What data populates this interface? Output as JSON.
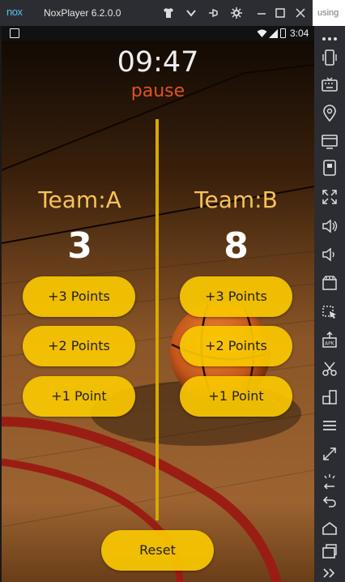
{
  "window": {
    "logo_text": "nox",
    "title": "NoxPlayer 6.2.0.0",
    "overflow_text": "using"
  },
  "statusbar": {
    "time": "3:04"
  },
  "game": {
    "timer": "09:47",
    "pause_label": "pause",
    "teams": [
      {
        "name": "Team:A",
        "score": "3"
      },
      {
        "name": "Team:B",
        "score": "8"
      }
    ],
    "buttons": {
      "plus3": "+3 Points",
      "plus2": "+2 Points",
      "plus1": "+1 Point",
      "reset": "Reset"
    }
  },
  "colors": {
    "accent_yellow": "#fac800",
    "team_label": "#f6c35a",
    "pause_orange": "#e0531c",
    "timer_text": "#eeeeee"
  },
  "sidebar_icons": [
    "more-icon",
    "phone-rotate-icon",
    "keyboard-icon",
    "location-icon",
    "screen-icon",
    "screenshot-icon",
    "fullscreen-icon",
    "volume-up-icon",
    "volume-down-icon",
    "video-record-icon",
    "macro-icon",
    "apk-install-icon",
    "cut-icon",
    "multi-instance-icon",
    "menu-icon",
    "zoom-icon",
    "shake-icon",
    "back-icon",
    "home-icon",
    "recent-apps-icon"
  ]
}
